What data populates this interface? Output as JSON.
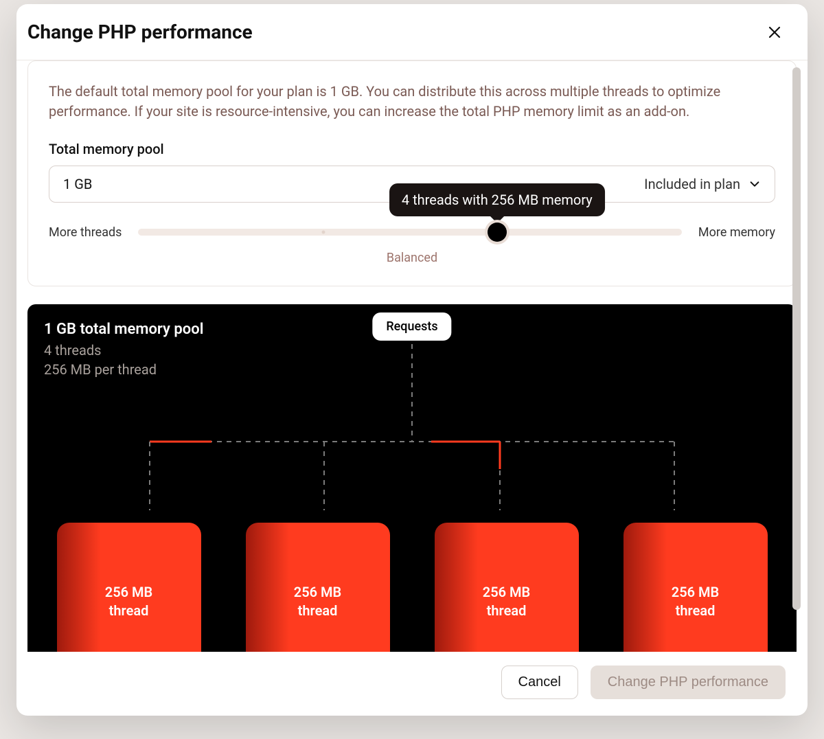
{
  "modal": {
    "title": "Change PHP performance"
  },
  "card": {
    "description": "The default total memory pool for your plan is 1 GB. You can distribute this across multiple threads to optimize performance. If your site is resource-intensive, you can increase the total PHP memory limit as an add-on.",
    "field_label": "Total memory pool",
    "dropdown_value": "1 GB",
    "dropdown_hint": "Included in plan"
  },
  "slider": {
    "left_label": "More threads",
    "right_label": "More memory",
    "mid_label": "Balanced",
    "tooltip": "4 threads with 256 MB memory",
    "position_percent": 66
  },
  "viz": {
    "pool_title": "1 GB total memory pool",
    "threads_line": "4 threads",
    "per_thread_line": "256 MB per thread",
    "requests_label": "Requests",
    "thread_label_size": "256 MB",
    "thread_label_word": "thread",
    "thread_count": 4
  },
  "footer": {
    "cancel": "Cancel",
    "confirm": "Change PHP performance"
  }
}
